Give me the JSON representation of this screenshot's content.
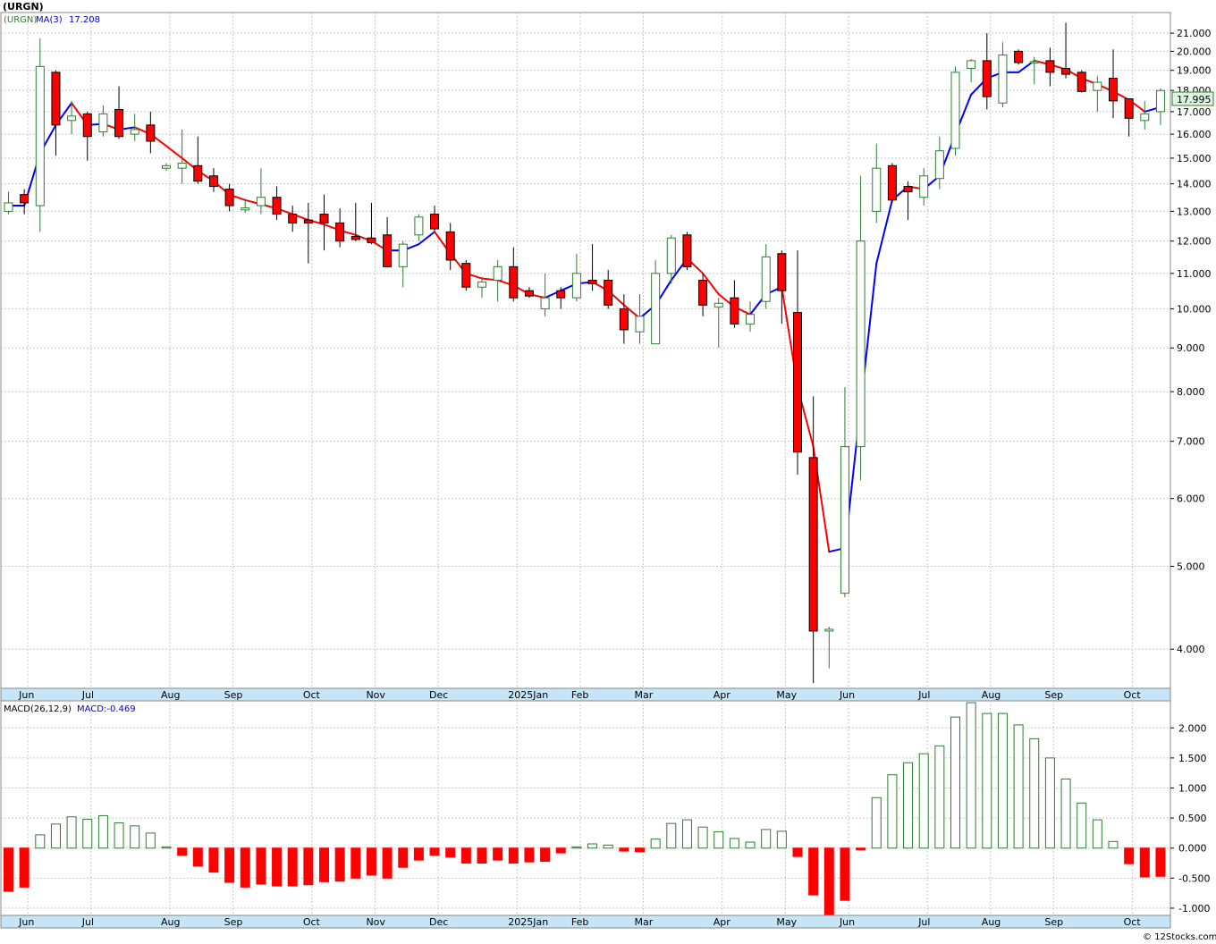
{
  "header": {
    "ticker": "(URGN)",
    "ma_label": "MA(3)",
    "ma_value": "17.208",
    "macd_label": "MACD(26,12,9)",
    "macd_value": "MACD:-0.469",
    "last_price": "17.995",
    "footer": "© 12Stocks.com"
  },
  "colors": {
    "up": "#2e7d32",
    "down": "#ff0000",
    "ma_up": "#0000ff",
    "ma_down": "#ff0000",
    "grid": "#c8c8c8",
    "axis_band": "#c6e6f7",
    "last_price_box": "#dff5df"
  },
  "chart_data": [
    {
      "type": "candlestick",
      "interval": "weekly",
      "scale": "log",
      "ylim": [
        3.6,
        22.2
      ],
      "yticks": [
        4,
        5,
        6,
        7,
        8,
        9,
        10,
        11,
        12,
        13,
        14,
        15,
        16,
        17,
        18,
        19,
        20,
        21
      ],
      "ytick_labels": [
        "4.000",
        "5.000",
        "6.000",
        "7.000",
        "8.000",
        "9.000",
        "10.000",
        "11.000",
        "12.000",
        "13.000",
        "14.000",
        "15.000",
        "16.000",
        "17.000",
        "18.000",
        "19.000",
        "20.000",
        "21.000"
      ],
      "xtick_labels": [
        {
          "label": "Jun",
          "bar": 1
        },
        {
          "label": "Jul",
          "bar": 5
        },
        {
          "label": "Aug",
          "bar": 10
        },
        {
          "label": "Sep",
          "bar": 14
        },
        {
          "label": "Oct",
          "bar": 19
        },
        {
          "label": "Nov",
          "bar": 23
        },
        {
          "label": "Dec",
          "bar": 27
        },
        {
          "label": "2025Jan",
          "bar": 32
        },
        {
          "label": "Feb",
          "bar": 36
        },
        {
          "label": "Mar",
          "bar": 40
        },
        {
          "label": "Apr",
          "bar": 45
        },
        {
          "label": "May",
          "bar": 49
        },
        {
          "label": "Jun",
          "bar": 53
        },
        {
          "label": "Jul",
          "bar": 58
        },
        {
          "label": "Aug",
          "bar": 62
        },
        {
          "label": "Sep",
          "bar": 66
        },
        {
          "label": "Oct",
          "bar": 71
        }
      ],
      "candles": [
        {
          "o": 13.0,
          "h": 13.7,
          "l": 12.9,
          "c": 13.3
        },
        {
          "o": 13.6,
          "h": 13.8,
          "l": 12.9,
          "c": 13.3
        },
        {
          "o": 13.2,
          "h": 20.7,
          "l": 12.3,
          "c": 19.2
        },
        {
          "o": 18.9,
          "h": 19.0,
          "l": 15.1,
          "c": 16.4
        },
        {
          "o": 16.6,
          "h": 17.5,
          "l": 16.0,
          "c": 16.8
        },
        {
          "o": 16.9,
          "h": 17.0,
          "l": 14.9,
          "c": 15.9
        },
        {
          "o": 16.1,
          "h": 17.3,
          "l": 15.9,
          "c": 16.9
        },
        {
          "o": 17.1,
          "h": 18.2,
          "l": 15.8,
          "c": 15.9
        },
        {
          "o": 16.0,
          "h": 16.9,
          "l": 15.7,
          "c": 16.2
        },
        {
          "o": 16.4,
          "h": 17.0,
          "l": 15.2,
          "c": 15.7
        },
        {
          "o": 14.6,
          "h": 14.8,
          "l": 14.5,
          "c": 14.7
        },
        {
          "o": 14.6,
          "h": 16.2,
          "l": 14.0,
          "c": 14.8
        },
        {
          "o": 14.7,
          "h": 15.9,
          "l": 14.0,
          "c": 14.1
        },
        {
          "o": 14.3,
          "h": 14.6,
          "l": 13.7,
          "c": 13.9
        },
        {
          "o": 13.8,
          "h": 14.0,
          "l": 13.0,
          "c": 13.2
        },
        {
          "o": 13.05,
          "h": 13.4,
          "l": 12.95,
          "c": 13.12
        },
        {
          "o": 13.2,
          "h": 14.6,
          "l": 12.9,
          "c": 13.5
        },
        {
          "o": 13.5,
          "h": 13.9,
          "l": 12.7,
          "c": 12.9
        },
        {
          "o": 12.9,
          "h": 13.2,
          "l": 12.3,
          "c": 12.6
        },
        {
          "o": 12.7,
          "h": 13.3,
          "l": 11.3,
          "c": 12.6
        },
        {
          "o": 12.9,
          "h": 13.6,
          "l": 11.7,
          "c": 12.6
        },
        {
          "o": 12.6,
          "h": 13.1,
          "l": 11.8,
          "c": 12.0
        },
        {
          "o": 12.15,
          "h": 13.3,
          "l": 12.0,
          "c": 12.05
        },
        {
          "o": 12.1,
          "h": 13.3,
          "l": 11.9,
          "c": 11.95
        },
        {
          "o": 12.2,
          "h": 12.8,
          "l": 11.2,
          "c": 11.2
        },
        {
          "o": 11.2,
          "h": 12.0,
          "l": 10.6,
          "c": 11.9
        },
        {
          "o": 12.2,
          "h": 12.9,
          "l": 12.0,
          "c": 12.8
        },
        {
          "o": 12.9,
          "h": 13.2,
          "l": 12.3,
          "c": 12.4
        },
        {
          "o": 12.3,
          "h": 12.6,
          "l": 11.1,
          "c": 11.4
        },
        {
          "o": 11.3,
          "h": 11.4,
          "l": 10.5,
          "c": 10.6
        },
        {
          "o": 10.6,
          "h": 10.9,
          "l": 10.3,
          "c": 10.75
        },
        {
          "o": 10.8,
          "h": 11.4,
          "l": 10.2,
          "c": 11.2
        },
        {
          "o": 11.2,
          "h": 11.8,
          "l": 10.2,
          "c": 10.3
        },
        {
          "o": 10.5,
          "h": 10.6,
          "l": 10.3,
          "c": 10.35
        },
        {
          "o": 10.0,
          "h": 11.0,
          "l": 9.8,
          "c": 10.3
        },
        {
          "o": 10.5,
          "h": 10.6,
          "l": 10.0,
          "c": 10.3
        },
        {
          "o": 10.3,
          "h": 11.6,
          "l": 10.2,
          "c": 11.0
        },
        {
          "o": 10.8,
          "h": 11.9,
          "l": 10.5,
          "c": 10.7
        },
        {
          "o": 10.8,
          "h": 11.1,
          "l": 10.0,
          "c": 10.1
        },
        {
          "o": 10.0,
          "h": 10.4,
          "l": 9.1,
          "c": 9.45
        },
        {
          "o": 9.4,
          "h": 10.4,
          "l": 9.1,
          "c": 9.8
        },
        {
          "o": 9.1,
          "h": 11.4,
          "l": 9.1,
          "c": 11.0
        },
        {
          "o": 11.0,
          "h": 12.2,
          "l": 10.7,
          "c": 12.1
        },
        {
          "o": 12.2,
          "h": 12.3,
          "l": 11.1,
          "c": 11.2
        },
        {
          "o": 10.8,
          "h": 11.0,
          "l": 9.8,
          "c": 10.1
        },
        {
          "o": 10.05,
          "h": 10.3,
          "l": 9.0,
          "c": 10.15
        },
        {
          "o": 10.3,
          "h": 10.8,
          "l": 9.5,
          "c": 9.6
        },
        {
          "o": 9.6,
          "h": 10.2,
          "l": 9.4,
          "c": 9.85
        },
        {
          "o": 10.2,
          "h": 11.9,
          "l": 10.0,
          "c": 11.5
        },
        {
          "o": 11.6,
          "h": 11.7,
          "l": 9.6,
          "c": 10.5
        },
        {
          "o": 9.9,
          "h": 11.7,
          "l": 6.4,
          "c": 6.8
        },
        {
          "o": 6.7,
          "h": 7.9,
          "l": 3.65,
          "c": 4.2
        },
        {
          "o": 4.2,
          "h": 4.25,
          "l": 3.8,
          "c": 4.22
        },
        {
          "o": 4.65,
          "h": 8.1,
          "l": 4.6,
          "c": 6.9
        },
        {
          "o": 6.9,
          "h": 14.3,
          "l": 6.3,
          "c": 12.0
        },
        {
          "o": 13.0,
          "h": 15.6,
          "l": 12.6,
          "c": 14.6
        },
        {
          "o": 14.7,
          "h": 14.8,
          "l": 13.3,
          "c": 13.4
        },
        {
          "o": 13.9,
          "h": 14.1,
          "l": 12.7,
          "c": 13.7
        },
        {
          "o": 13.5,
          "h": 14.6,
          "l": 13.2,
          "c": 14.3
        },
        {
          "o": 14.2,
          "h": 15.9,
          "l": 13.8,
          "c": 15.3
        },
        {
          "o": 15.4,
          "h": 19.2,
          "l": 15.1,
          "c": 18.9
        },
        {
          "o": 19.1,
          "h": 19.6,
          "l": 18.4,
          "c": 19.5
        },
        {
          "o": 19.5,
          "h": 21.0,
          "l": 17.1,
          "c": 17.7
        },
        {
          "o": 17.4,
          "h": 20.5,
          "l": 17.2,
          "c": 19.8
        },
        {
          "o": 20.0,
          "h": 20.1,
          "l": 19.3,
          "c": 19.4
        },
        {
          "o": 19.4,
          "h": 19.7,
          "l": 18.3,
          "c": 19.45
        },
        {
          "o": 19.5,
          "h": 20.2,
          "l": 18.2,
          "c": 18.9
        },
        {
          "o": 19.1,
          "h": 21.6,
          "l": 18.6,
          "c": 18.8
        },
        {
          "o": 18.9,
          "h": 19.0,
          "l": 17.9,
          "c": 17.95
        },
        {
          "o": 18.0,
          "h": 18.7,
          "l": 17.0,
          "c": 18.4
        },
        {
          "o": 18.6,
          "h": 20.1,
          "l": 16.7,
          "c": 17.5
        },
        {
          "o": 17.6,
          "h": 17.6,
          "l": 15.9,
          "c": 16.7
        },
        {
          "o": 16.6,
          "h": 17.5,
          "l": 16.2,
          "c": 16.9
        },
        {
          "o": 17.0,
          "h": 18.1,
          "l": 16.4,
          "c": 17.995
        }
      ],
      "ma3": [
        {
          "bar": 0,
          "v": 13.2
        },
        {
          "bar": 1,
          "v": 13.2
        },
        {
          "bar": 2,
          "v": 15.2
        },
        {
          "bar": 3,
          "v": 16.4
        },
        {
          "bar": 4,
          "v": 17.4
        },
        {
          "bar": 5,
          "v": 16.4
        },
        {
          "bar": 6,
          "v": 16.45
        },
        {
          "bar": 7,
          "v": 16.2
        },
        {
          "bar": 8,
          "v": 16.3
        },
        {
          "bar": 9,
          "v": 16.0
        },
        {
          "bar": 10,
          "v": 15.5
        },
        {
          "bar": 11,
          "v": 15.0
        },
        {
          "bar": 12,
          "v": 14.5
        },
        {
          "bar": 13,
          "v": 14.1
        },
        {
          "bar": 14,
          "v": 13.6
        },
        {
          "bar": 15,
          "v": 13.4
        },
        {
          "bar": 16,
          "v": 13.25
        },
        {
          "bar": 17,
          "v": 13.1
        },
        {
          "bar": 18,
          "v": 12.9
        },
        {
          "bar": 19,
          "v": 12.7
        },
        {
          "bar": 20,
          "v": 12.55
        },
        {
          "bar": 21,
          "v": 12.35
        },
        {
          "bar": 22,
          "v": 12.2
        },
        {
          "bar": 23,
          "v": 12.0
        },
        {
          "bar": 24,
          "v": 11.7
        },
        {
          "bar": 25,
          "v": 11.7
        },
        {
          "bar": 26,
          "v": 11.9
        },
        {
          "bar": 27,
          "v": 12.3
        },
        {
          "bar": 28,
          "v": 11.6
        },
        {
          "bar": 29,
          "v": 11.0
        },
        {
          "bar": 30,
          "v": 10.85
        },
        {
          "bar": 31,
          "v": 10.8
        },
        {
          "bar": 32,
          "v": 10.65
        },
        {
          "bar": 33,
          "v": 10.4
        },
        {
          "bar": 34,
          "v": 10.3
        },
        {
          "bar": 35,
          "v": 10.5
        },
        {
          "bar": 36,
          "v": 10.7
        },
        {
          "bar": 37,
          "v": 10.75
        },
        {
          "bar": 38,
          "v": 10.5
        },
        {
          "bar": 39,
          "v": 10.1
        },
        {
          "bar": 40,
          "v": 9.75
        },
        {
          "bar": 41,
          "v": 10.1
        },
        {
          "bar": 42,
          "v": 10.8
        },
        {
          "bar": 43,
          "v": 11.45
        },
        {
          "bar": 44,
          "v": 11.0
        },
        {
          "bar": 45,
          "v": 10.4
        },
        {
          "bar": 46,
          "v": 10.05
        },
        {
          "bar": 47,
          "v": 9.85
        },
        {
          "bar": 48,
          "v": 10.4
        },
        {
          "bar": 49,
          "v": 10.6
        },
        {
          "bar": 50,
          "v": 8.1
        },
        {
          "bar": 51,
          "v": 6.9
        },
        {
          "bar": 52,
          "v": 5.2
        },
        {
          "bar": 53,
          "v": 5.25
        },
        {
          "bar": 54,
          "v": 7.7
        },
        {
          "bar": 55,
          "v": 11.3
        },
        {
          "bar": 56,
          "v": 13.4
        },
        {
          "bar": 57,
          "v": 13.9
        },
        {
          "bar": 58,
          "v": 13.8
        },
        {
          "bar": 59,
          "v": 14.3
        },
        {
          "bar": 60,
          "v": 16.0
        },
        {
          "bar": 61,
          "v": 17.8
        },
        {
          "bar": 62,
          "v": 18.6
        },
        {
          "bar": 63,
          "v": 18.9
        },
        {
          "bar": 64,
          "v": 18.9
        },
        {
          "bar": 65,
          "v": 19.5
        },
        {
          "bar": 66,
          "v": 19.3
        },
        {
          "bar": 67,
          "v": 19.05
        },
        {
          "bar": 68,
          "v": 18.6
        },
        {
          "bar": 69,
          "v": 18.3
        },
        {
          "bar": 70,
          "v": 17.95
        },
        {
          "bar": 71,
          "v": 17.55
        },
        {
          "bar": 72,
          "v": 17.0
        },
        {
          "bar": 73,
          "v": 17.21
        }
      ]
    },
    {
      "type": "bar",
      "ylim": [
        -1.12,
        2.45
      ],
      "yticks": [
        -1.0,
        -0.5,
        0.0,
        0.5,
        1.0,
        1.5,
        2.0
      ],
      "ytick_labels": [
        "-1.000",
        "-0.500",
        "0.000",
        "0.500",
        "1.000",
        "1.500",
        "2.000"
      ],
      "values": [
        -0.72,
        -0.65,
        0.22,
        0.4,
        0.52,
        0.48,
        0.54,
        0.42,
        0.37,
        0.25,
        0.02,
        -0.12,
        -0.3,
        -0.4,
        -0.57,
        -0.65,
        -0.6,
        -0.63,
        -0.63,
        -0.61,
        -0.56,
        -0.55,
        -0.5,
        -0.45,
        -0.5,
        -0.32,
        -0.2,
        -0.12,
        -0.15,
        -0.25,
        -0.25,
        -0.2,
        -0.25,
        -0.23,
        -0.22,
        -0.08,
        0.02,
        0.07,
        0.05,
        -0.05,
        -0.06,
        0.15,
        0.41,
        0.47,
        0.35,
        0.27,
        0.16,
        0.1,
        0.31,
        0.28,
        -0.14,
        -0.78,
        -1.12,
        -0.87,
        -0.03,
        0.84,
        1.22,
        1.42,
        1.57,
        1.7,
        2.18,
        2.42,
        2.24,
        2.24,
        2.05,
        1.82,
        1.5,
        1.15,
        0.75,
        0.47,
        0.11,
        -0.26,
        -0.48,
        -0.47
      ]
    }
  ]
}
